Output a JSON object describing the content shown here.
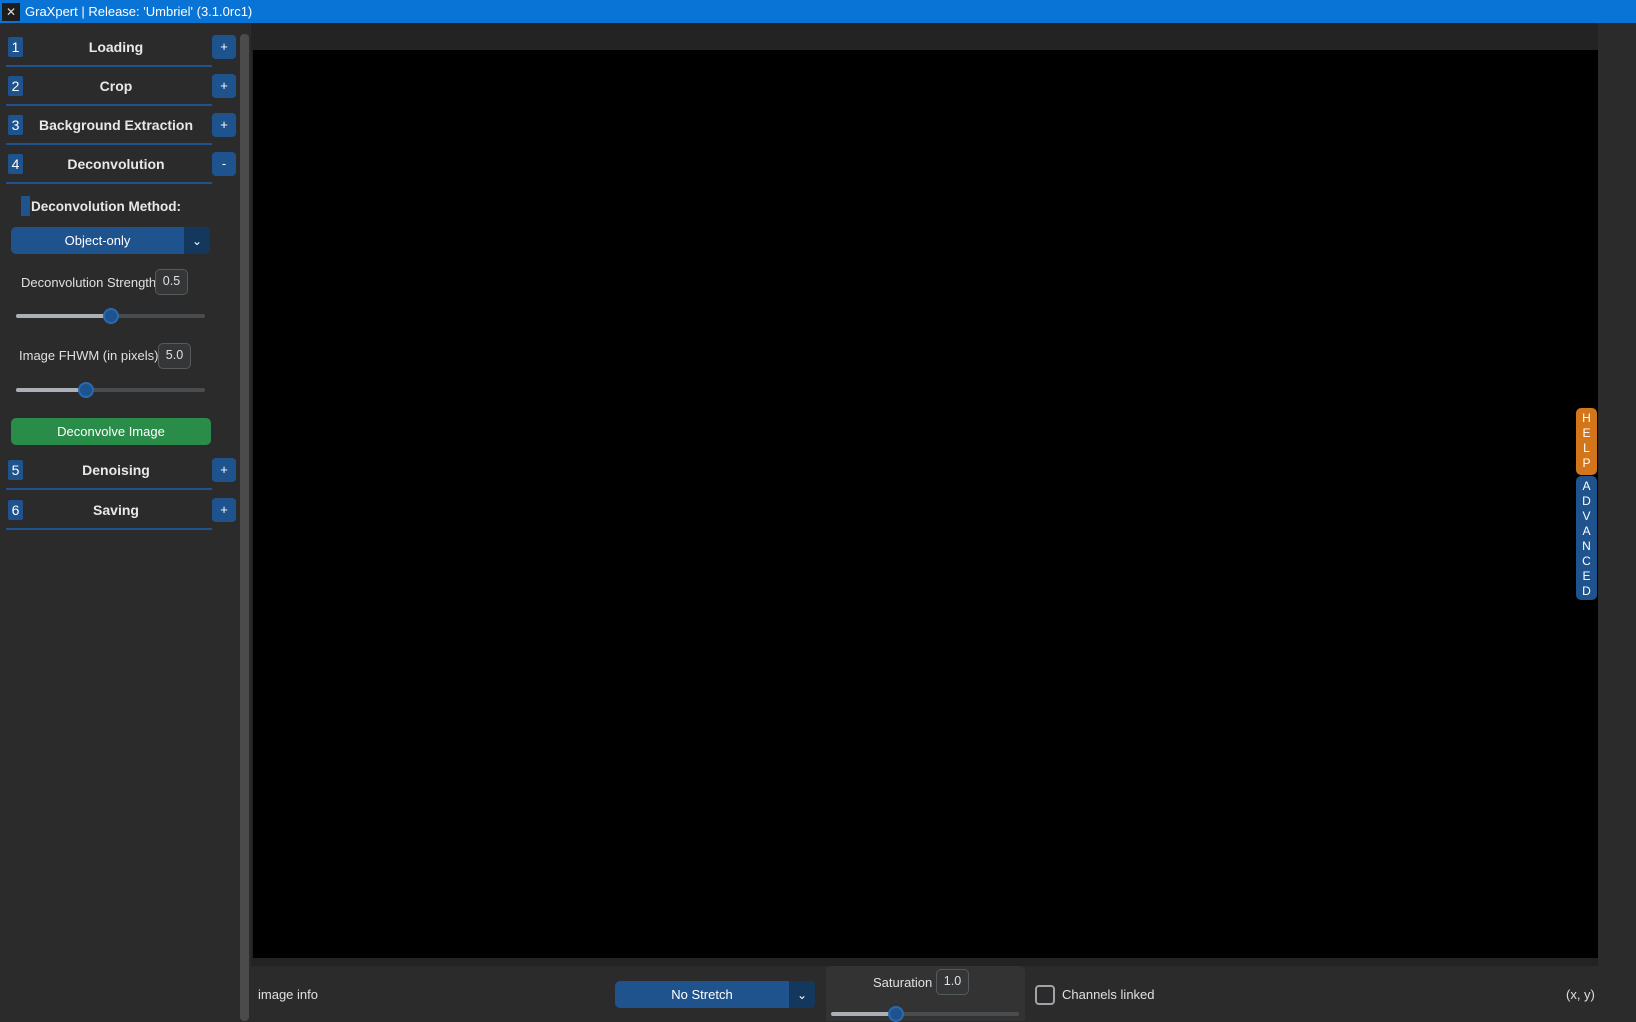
{
  "window": {
    "title": "GraXpert | Release: 'Umbriel' (3.1.0rc1)",
    "icon": "graxpert-logo-icon"
  },
  "sidebar": {
    "sections": [
      {
        "number": "1",
        "title": "Loading",
        "toggle": "+"
      },
      {
        "number": "2",
        "title": "Crop",
        "toggle": "+"
      },
      {
        "number": "3",
        "title": "Background Extraction",
        "toggle": "+"
      },
      {
        "number": "4",
        "title": "Deconvolution",
        "toggle": "-"
      },
      {
        "number": "5",
        "title": "Denoising",
        "toggle": "+"
      },
      {
        "number": "6",
        "title": "Saving",
        "toggle": "+"
      }
    ],
    "deconvolution": {
      "method_label": "Deconvolution Method:",
      "method_value": "Object-only",
      "strength_label": "Deconvolution Strength",
      "strength_value": "0.5",
      "strength_fraction": 0.5,
      "fwhm_label": "Image FHWM (in pixels)",
      "fwhm_value": "5.0",
      "fwhm_fraction": 0.36,
      "action_label": "Deconvolve Image"
    }
  },
  "side_tabs": {
    "help": "HELP",
    "advanced": "ADVANCED"
  },
  "bottom_bar": {
    "image_info": "image info",
    "stretch_value": "No Stretch",
    "saturation_label": "Saturation",
    "saturation_value": "1.0",
    "saturation_fraction": 0.33,
    "channels_linked_label": "Channels linked",
    "channels_linked_checked": false,
    "coords": "(x, y)"
  },
  "colors": {
    "accent": "#1f538d",
    "action_green": "#2a8c49",
    "help_orange": "#d2751b",
    "titlebar": "#0a74d6"
  }
}
